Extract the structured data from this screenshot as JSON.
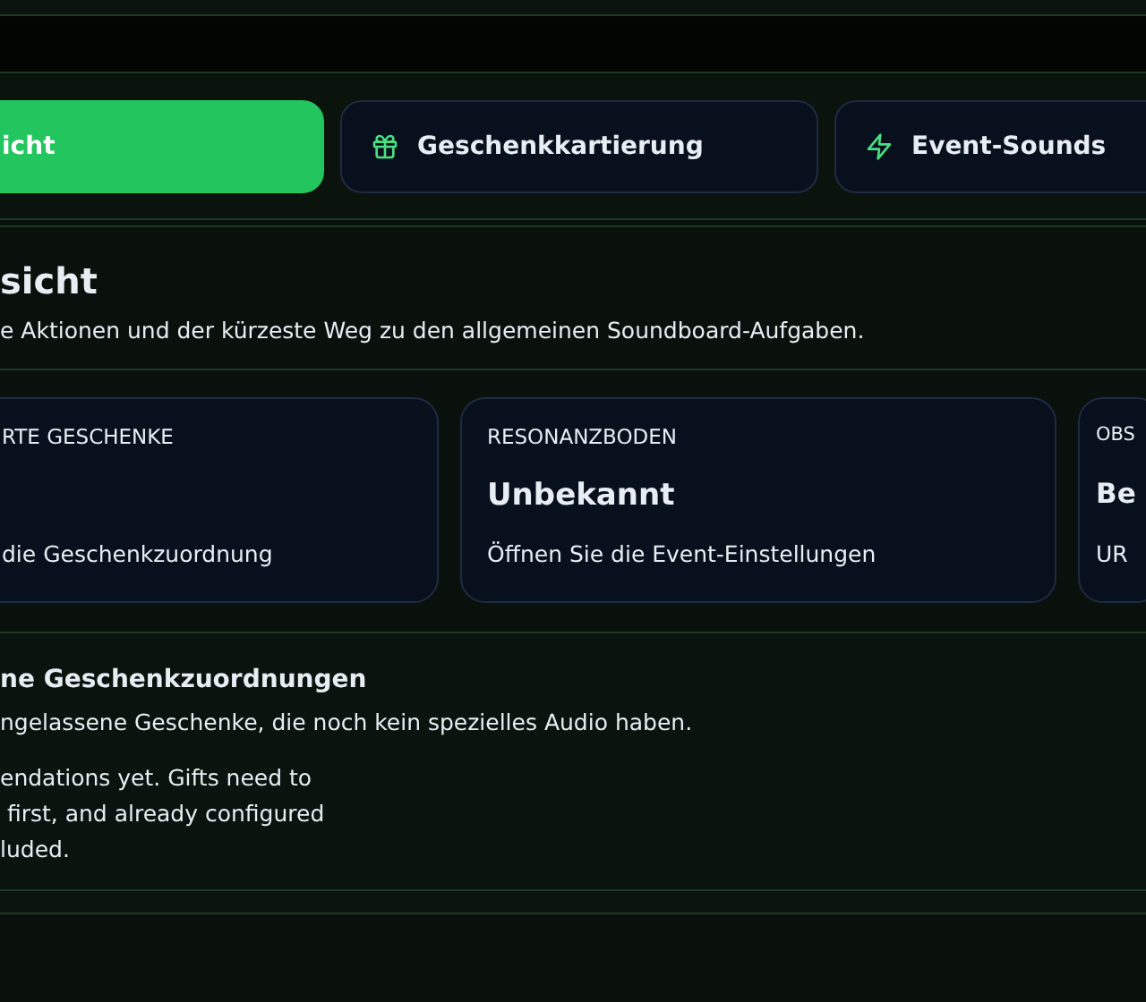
{
  "tabs": [
    {
      "label": "icht",
      "selected": true,
      "kind": "plain"
    },
    {
      "label": "Geschenkkartierung",
      "selected": false,
      "kind": "gift"
    },
    {
      "label": "Event-Sounds",
      "selected": false,
      "kind": "bolt"
    }
  ],
  "overview": {
    "title": "sicht",
    "subtitle": "e Aktionen und der kürzeste Weg zu den allgemeinen Soundboard-Aufgaben.",
    "cards": [
      {
        "label": "RTE GESCHENKE",
        "hint": "die Geschenkzuordnung"
      },
      {
        "label": "RESONANZBODEN",
        "value": "Unbekannt",
        "hint": "Öffnen Sie die Event-Einstellungen"
      },
      {
        "label": "OBS",
        "value": "Be",
        "hint": "UR"
      }
    ]
  },
  "recommendations": {
    "title": "ne Geschenkzuordnungen",
    "subtitle": "ngelassene Geschenke, die noch kein spezielles Audio haben.",
    "empty": "endations yet. Gifts need to\n first, and already configured\nluded."
  }
}
